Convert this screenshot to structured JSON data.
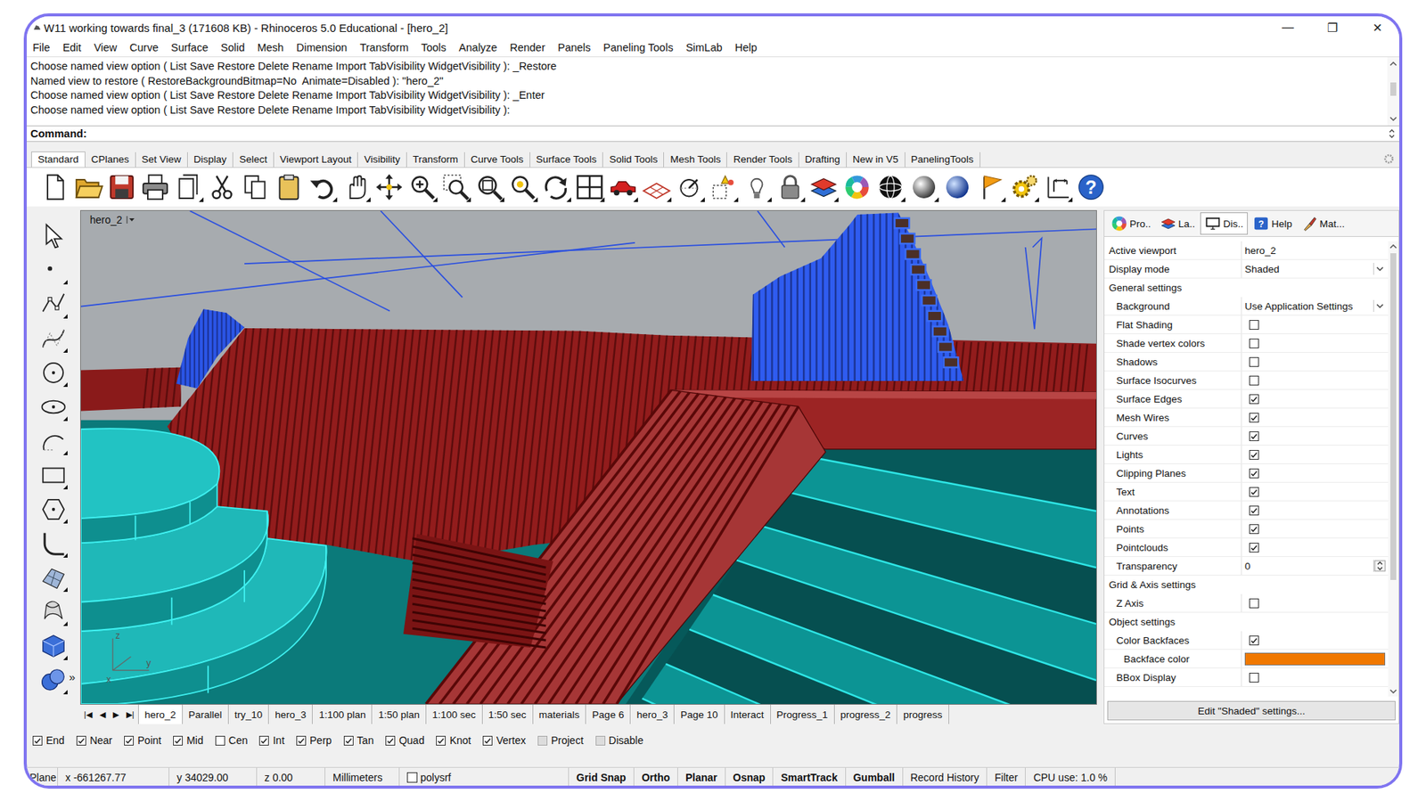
{
  "window": {
    "title": "W11 working towards final_3 (171608 KB) - Rhinoceros 5.0 Educational - [hero_2]",
    "controls": [
      "—",
      "❐",
      "✕"
    ]
  },
  "menu": [
    "File",
    "Edit",
    "View",
    "Curve",
    "Surface",
    "Solid",
    "Mesh",
    "Dimension",
    "Transform",
    "Tools",
    "Analyze",
    "Render",
    "Panels",
    "Paneling Tools",
    "SimLab",
    "Help"
  ],
  "command_history": [
    "Choose named view option ( List Save Restore Delete Rename Import TabVisibility WidgetVisibility ): _Restore",
    "Named view to restore ( RestoreBackgroundBitmap=No  Animate=Disabled ): \"hero_2\"",
    "Choose named view option ( List Save Restore Delete Rename Import TabVisibility WidgetVisibility ): _Enter",
    "Choose named view option ( List Save Restore Delete Rename Import TabVisibility WidgetVisibility ):"
  ],
  "command_prompt": "Command:",
  "toolbar_tabs": [
    {
      "label": "Standard",
      "selected": true
    },
    {
      "label": "CPlanes",
      "selected": false
    },
    {
      "label": "Set View",
      "selected": false
    },
    {
      "label": "Display",
      "selected": false
    },
    {
      "label": "Select",
      "selected": false
    },
    {
      "label": "Viewport Layout",
      "selected": false
    },
    {
      "label": "Visibility",
      "selected": false
    },
    {
      "label": "Transform",
      "selected": false
    },
    {
      "label": "Curve Tools",
      "selected": false
    },
    {
      "label": "Surface Tools",
      "selected": false
    },
    {
      "label": "Solid Tools",
      "selected": false
    },
    {
      "label": "Mesh Tools",
      "selected": false
    },
    {
      "label": "Render Tools",
      "selected": false
    },
    {
      "label": "Drafting",
      "selected": false
    },
    {
      "label": "New in V5",
      "selected": false
    },
    {
      "label": "PanelingTools",
      "selected": false
    }
  ],
  "toolbar": {
    "help_glyph": "?"
  },
  "side_toolbar": {
    "more_glyph": "»"
  },
  "viewport": {
    "title": "hero_2",
    "axis_labels": [
      "x",
      "y",
      "z"
    ]
  },
  "viewport_tabs": {
    "nav": [
      "|◀",
      "◀",
      "▶",
      "▶|"
    ],
    "tabs": [
      {
        "label": "hero_2",
        "selected": true
      },
      {
        "label": "Parallel",
        "selected": false
      },
      {
        "label": "try_10",
        "selected": false
      },
      {
        "label": "hero_3",
        "selected": false
      },
      {
        "label": "1:100 plan",
        "selected": false
      },
      {
        "label": "1:50 plan",
        "selected": false
      },
      {
        "label": "1:100 sec",
        "selected": false
      },
      {
        "label": "1:50 sec",
        "selected": false
      },
      {
        "label": "materials",
        "selected": false
      },
      {
        "label": "Page 6",
        "selected": false
      },
      {
        "label": "hero_3",
        "selected": false
      },
      {
        "label": "Page 10",
        "selected": false
      },
      {
        "label": "Interact",
        "selected": false
      },
      {
        "label": "Progress_1",
        "selected": false
      },
      {
        "label": "progress_2",
        "selected": false
      },
      {
        "label": "progress",
        "selected": false
      }
    ]
  },
  "panel": {
    "tabs": [
      {
        "label": "Pro..",
        "selected": false
      },
      {
        "label": "La..",
        "selected": false
      },
      {
        "label": "Dis..",
        "selected": true
      },
      {
        "label": "Help",
        "selected": false
      },
      {
        "label": "Mat...",
        "selected": false
      }
    ],
    "rows": [
      {
        "kind": "value",
        "label": "Active viewport",
        "value": "hero_2"
      },
      {
        "kind": "dropdown",
        "label": "Display mode",
        "value": "Shaded"
      },
      {
        "kind": "section",
        "label": "General settings"
      },
      {
        "kind": "choice",
        "label": "Background",
        "value": "Use Application Settings"
      },
      {
        "kind": "checkbox",
        "label": "Flat Shading",
        "checked": false
      },
      {
        "kind": "checkbox",
        "label": "Shade vertex colors",
        "checked": false
      },
      {
        "kind": "checkbox",
        "label": "Shadows",
        "checked": false
      },
      {
        "kind": "checkbox",
        "label": "Surface Isocurves",
        "checked": false
      },
      {
        "kind": "checkbox",
        "label": "Surface Edges",
        "checked": true
      },
      {
        "kind": "checkbox",
        "label": "Mesh Wires",
        "checked": true
      },
      {
        "kind": "checkbox",
        "label": "Curves",
        "checked": true
      },
      {
        "kind": "checkbox",
        "label": "Lights",
        "checked": true
      },
      {
        "kind": "checkbox",
        "label": "Clipping Planes",
        "checked": true
      },
      {
        "kind": "checkbox",
        "label": "Text",
        "checked": true
      },
      {
        "kind": "checkbox",
        "label": "Annotations",
        "checked": true
      },
      {
        "kind": "checkbox",
        "label": "Points",
        "checked": true
      },
      {
        "kind": "checkbox",
        "label": "Pointclouds",
        "checked": true
      },
      {
        "kind": "spinner",
        "label": "Transparency",
        "value": "0"
      },
      {
        "kind": "section",
        "label": "Grid & Axis settings"
      },
      {
        "kind": "checkbox",
        "label": "Z Axis",
        "checked": false
      },
      {
        "kind": "section",
        "label": "Object settings"
      },
      {
        "kind": "checkbox",
        "label": "Color Backfaces",
        "checked": true
      },
      {
        "kind": "color",
        "label": "Backface color",
        "color": "#f07800"
      },
      {
        "kind": "checkbox",
        "label": "BBox Display",
        "checked": false
      }
    ],
    "button": "Edit \"Shaded\" settings..."
  },
  "osnaps": [
    {
      "label": "End",
      "checked": true,
      "disabled": false
    },
    {
      "label": "Near",
      "checked": true,
      "disabled": false
    },
    {
      "label": "Point",
      "checked": true,
      "disabled": false
    },
    {
      "label": "Mid",
      "checked": true,
      "disabled": false
    },
    {
      "label": "Cen",
      "checked": false,
      "disabled": false
    },
    {
      "label": "Int",
      "checked": true,
      "disabled": false
    },
    {
      "label": "Perp",
      "checked": true,
      "disabled": false
    },
    {
      "label": "Tan",
      "checked": true,
      "disabled": false
    },
    {
      "label": "Quad",
      "checked": true,
      "disabled": false
    },
    {
      "label": "Knot",
      "checked": true,
      "disabled": false
    },
    {
      "label": "Vertex",
      "checked": true,
      "disabled": false
    },
    {
      "label": "Project",
      "checked": false,
      "disabled": true
    },
    {
      "label": "Disable",
      "checked": false,
      "disabled": true
    }
  ],
  "status_bar": {
    "plane": "Plane",
    "x": "x -661267.77",
    "y": "y 34029.00",
    "z": "z 0.00",
    "units": "Millimeters",
    "layer": "polysrf",
    "toggles": [
      {
        "label": "Grid Snap",
        "on": true
      },
      {
        "label": "Ortho",
        "on": true
      },
      {
        "label": "Planar",
        "on": true
      },
      {
        "label": "Osnap",
        "on": true
      },
      {
        "label": "SmartTrack",
        "on": true
      },
      {
        "label": "Gumball",
        "on": true
      },
      {
        "label": "Record History",
        "on": false
      },
      {
        "label": "Filter",
        "on": false
      }
    ],
    "cpu": "CPU use: 1.0 %"
  }
}
